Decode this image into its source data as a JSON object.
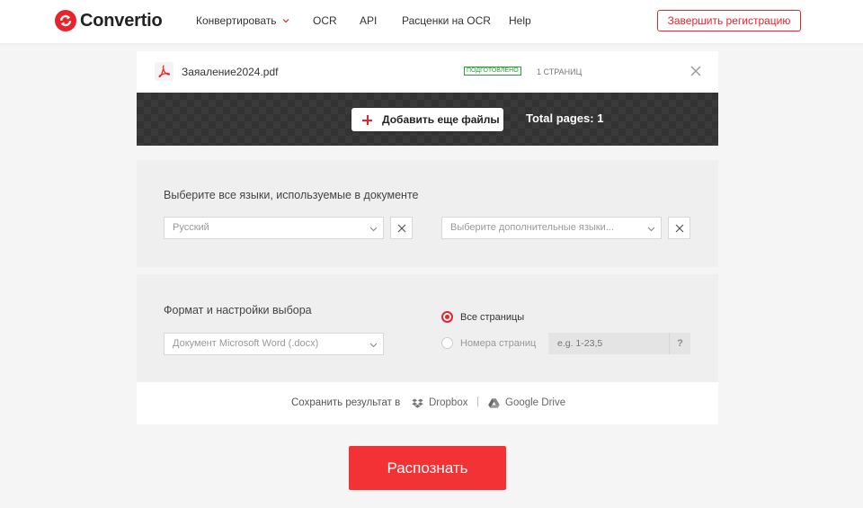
{
  "header": {
    "brand": "Convertio",
    "nav": [
      {
        "label": "Конвертировать",
        "has_dropdown": true
      },
      {
        "label": "OCR"
      },
      {
        "label": "API"
      },
      {
        "label": "Расценки на OCR"
      },
      {
        "label": "Help"
      }
    ],
    "signup_label": "Завершить регистрацию"
  },
  "file": {
    "name": "Заяаление2024.pdf",
    "status": "подготовлено",
    "pages": "1 страниц",
    "icon": "pdf-icon"
  },
  "toolbar": {
    "add_files_label": "Добавить еще файлы",
    "total_pages": "Total pages: 1"
  },
  "language": {
    "title": "Выберите все языки, используемые в документе",
    "primary_value": "Русский",
    "extra_placeholder": "Выберите дополнительные языки..."
  },
  "format": {
    "title": "Формат и настройки выбора",
    "selected": "Документ Microsoft Word (.docx)",
    "all_pages_label": "Все страницы",
    "page_numbers_label": "Номера страниц",
    "page_numbers_placeholder": "e.g. 1-23,5",
    "help": "?",
    "selected_option": "all_pages"
  },
  "save": {
    "label": "Сохранить результат в",
    "dropbox": "Dropbox",
    "separator": "|",
    "gdrive": "Google Drive"
  },
  "action": {
    "recognize_label": "Распознать"
  },
  "colors": {
    "accent": "#e8232b",
    "button": "#f23234",
    "status": "#2e9b3a"
  }
}
